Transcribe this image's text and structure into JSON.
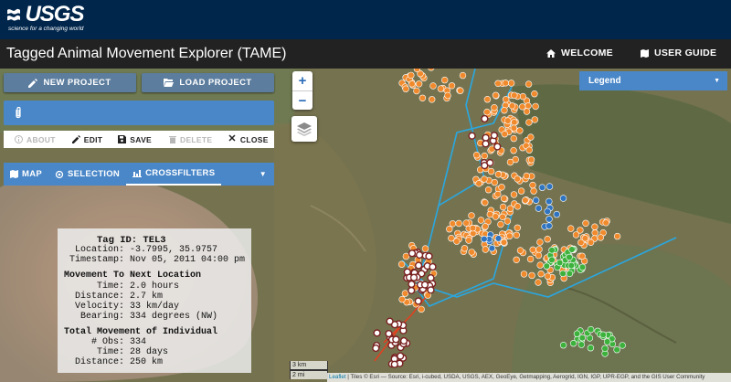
{
  "brand": {
    "name": "USGS",
    "tagline": "science for a changing world"
  },
  "app": {
    "title": "Tagged Animal Movement Explorer (TAME)"
  },
  "nav": {
    "welcome": "WELCOME",
    "user_guide": "USER GUIDE"
  },
  "toolbar": {
    "new_project": "NEW PROJECT",
    "load_project": "LOAD PROJECT"
  },
  "actions": {
    "about": "ABOUT",
    "edit": "EDIT",
    "save": "SAVE",
    "delete": "DELETE",
    "close": "CLOSE"
  },
  "tabs": {
    "map": "MAP",
    "selection": "SELECTION",
    "crossfilters": "CROSSFILTERS",
    "active": "crossfilters"
  },
  "map_controls": {
    "zoom_in": "+",
    "zoom_out": "−"
  },
  "legend": {
    "label": "Legend"
  },
  "info": {
    "tag_line": "Tag ID: TEL3",
    "location": "Location: -3.7995, 35.9757",
    "timestamp": "Timestamp: Nov 05, 2011 04:00 pm",
    "next_heading": "Movement To Next Location",
    "time": "Time: 2.0 hours",
    "distance": "Distance: 2.7 km",
    "velocity": "Velocity: 33 km/day",
    "bearing": "Bearing: 334 degrees (NW)",
    "total_heading": "Total Movement of Individual",
    "obs": "# Obs: 334",
    "total_time": "Time: 28 days",
    "total_distance": "Distance: 250 km"
  },
  "scale": {
    "km": "3 km",
    "mi": "2 mi"
  },
  "attribution": {
    "leaflet": "Leaflet",
    "text": " | Tiles © Esri — Source: Esri, i-cubed, USDA, USGS, AEX, GeoEye, Getmapping, Aerogrid, IGN, IGP, UPR-EGP, and the GIS User Community"
  },
  "colors": {
    "header_navy": "#00264c",
    "app_bar": "#222222",
    "panel_blue": "#4a87c8",
    "button_blue": "#5c7d9e",
    "points_orange": "#f08a2c",
    "points_green": "#3cb23c",
    "points_blue": "#2f74c0",
    "track_cyan": "#2aa7e0",
    "track_red": "#e04020"
  }
}
